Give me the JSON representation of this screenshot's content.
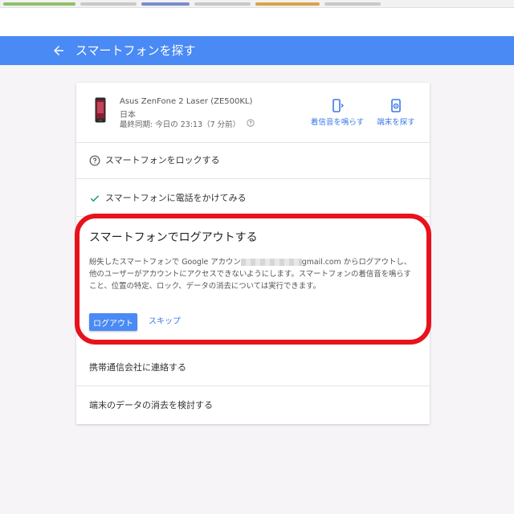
{
  "appbar": {
    "title": "スマートフォンを探す"
  },
  "device": {
    "name": "Asus ZenFone 2 Laser (ZE500KL)",
    "country": "日本",
    "last_sync": "最終同期: 今日の 23:13（7 分前）"
  },
  "actions": {
    "ring_label": "着信音を鳴らす",
    "find_label": "端末を探す"
  },
  "rows": {
    "lock_label": "スマートフォンをロックする",
    "call_label": "スマートフォンに電話をかけてみる",
    "carrier_label": "携帯通信会社に連絡する",
    "erase_label": "端末のデータの消去を検討する"
  },
  "logout_panel": {
    "title": "スマートフォンでログアウトする",
    "body_before": "紛失したスマートフォンで Google アカウン",
    "body_after": "gmail.com からログアウトし、他のユーザーがアカウントにアクセスできないようにします。スマートフォンの着信音を鳴らすこと、位置の特定、ロック、データの消去については実行できます。",
    "logout_button": "ログアウト",
    "skip_button": "スキップ"
  },
  "colors": {
    "accent": "#4a8af4",
    "link": "#3b78e7",
    "highlight": "#e8121c",
    "check": "#0f9d58"
  }
}
